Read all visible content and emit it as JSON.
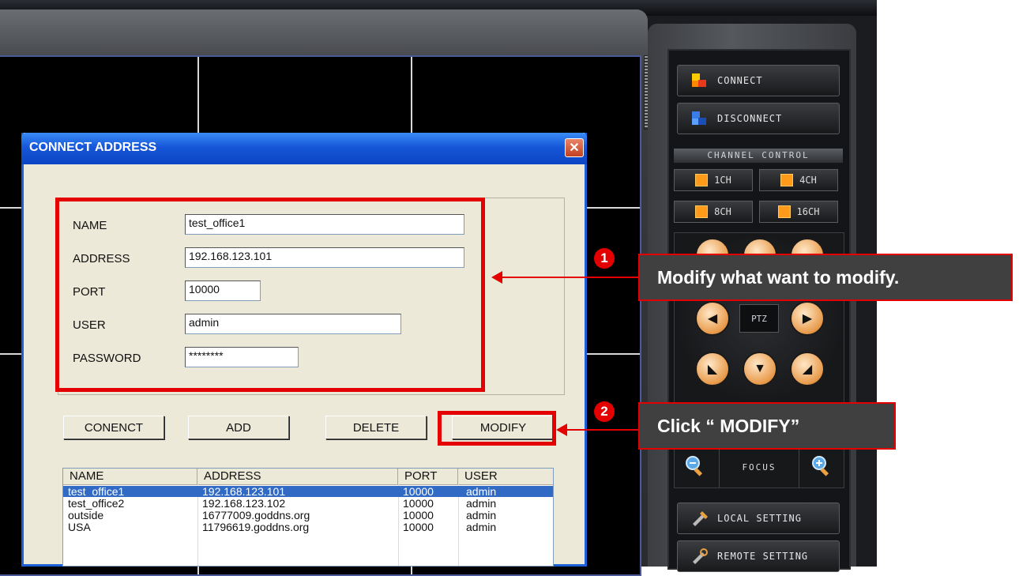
{
  "dialog": {
    "title": "CONNECT ADDRESS",
    "close_glyph": "✕",
    "fields": {
      "name_label": "NAME",
      "name_value": "test_office1",
      "address_label": "ADDRESS",
      "address_value": "192.168.123.101",
      "port_label": "PORT",
      "port_value": "10000",
      "user_label": "USER",
      "user_value": "admin",
      "password_label": "PASSWORD",
      "password_value": "********"
    },
    "buttons": {
      "connect": "CONENCT",
      "add": "ADD",
      "delete": "DELETE",
      "modify": "MODIFY"
    },
    "list": {
      "headers": [
        "NAME",
        "ADDRESS",
        "PORT",
        "USER"
      ],
      "rows": [
        [
          "test_office1",
          "192.168.123.101",
          "10000",
          "admin"
        ],
        [
          "test_office2",
          "192.168.123.102",
          "10000",
          "admin"
        ],
        [
          "outside",
          "16777009.goddns.org",
          "10000",
          "admin"
        ],
        [
          "USA",
          "11796619.goddns.org",
          "10000",
          "admin"
        ]
      ],
      "selected_row": 0
    }
  },
  "panel": {
    "connect": "CONNECT",
    "disconnect": "DISCONNECT",
    "channel_control": "CHANNEL CONTROL",
    "ch1": "1CH",
    "ch4": "4CH",
    "ch8": "8CH",
    "ch16": "16CH",
    "ptz": "PTZ",
    "focus": "FOCUS",
    "local_setting": "LOCAL SETTING",
    "remote_setting": "REMOTE SETTING",
    "icons": [
      "connect-icon",
      "disconnect-icon",
      "channel-icon",
      "arrow-icon",
      "magnifier-minus-icon",
      "magnifier-plus-icon",
      "tools-icon",
      "remote-tools-icon"
    ]
  },
  "annotations": {
    "badge1": "1",
    "badge2": "2",
    "callout1": "Modify what want to modify.",
    "callout2": "Click “ MODIFY”"
  },
  "colors": {
    "highlight": "#e40000",
    "callout_bg": "#404040",
    "selection": "#316ac5",
    "title_blue": "#1656d8",
    "ptz_orange": "#e89a4a"
  }
}
